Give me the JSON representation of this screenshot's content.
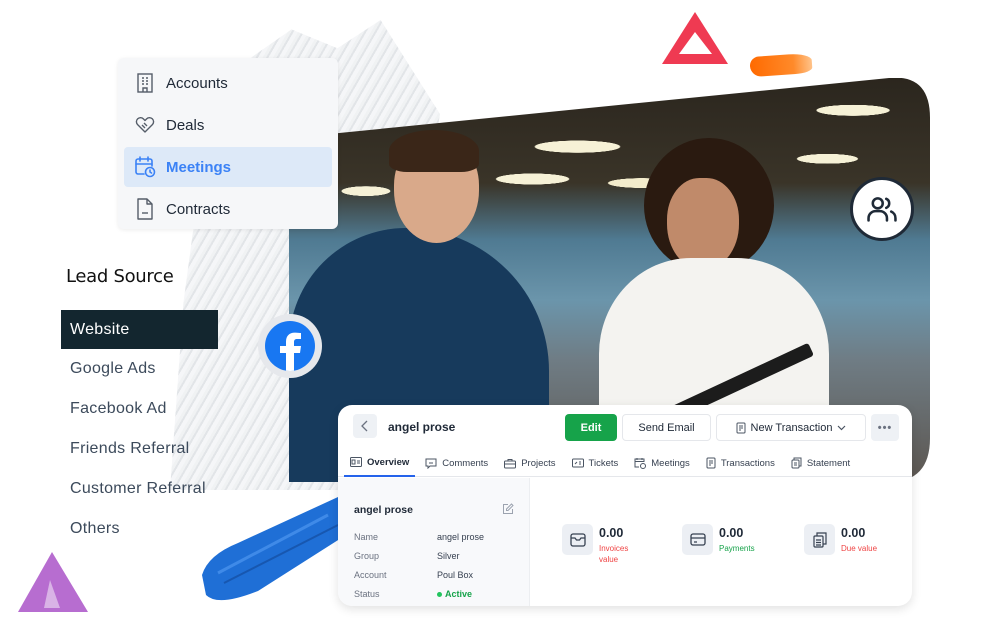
{
  "nav_menu": {
    "items": [
      {
        "label": "Accounts",
        "icon": "building-icon",
        "active": false
      },
      {
        "label": "Deals",
        "icon": "handshake-heart-icon",
        "active": false
      },
      {
        "label": "Meetings",
        "icon": "calendar-clock-icon",
        "active": true
      },
      {
        "label": "Contracts",
        "icon": "document-icon",
        "active": false
      }
    ]
  },
  "lead_source": {
    "title": "Lead Source",
    "items": [
      {
        "label": "Website",
        "active": true
      },
      {
        "label": "Google Ads",
        "active": false
      },
      {
        "label": "Facebook Ad",
        "active": false
      },
      {
        "label": "Friends Referral",
        "active": false
      },
      {
        "label": "Customer Referral",
        "active": false
      },
      {
        "label": "Others",
        "active": false
      }
    ]
  },
  "badges": {
    "people": "people-icon",
    "facebook": "facebook-icon"
  },
  "record": {
    "title": "angel prose",
    "buttons": {
      "edit": "Edit",
      "send_email": "Send Email",
      "new_transaction": "New Transaction",
      "more": "•••"
    },
    "tabs": [
      {
        "label": "Overview",
        "icon": "id-card-icon",
        "active": true
      },
      {
        "label": "Comments",
        "icon": "comment-icon",
        "active": false
      },
      {
        "label": "Projects",
        "icon": "briefcase-icon",
        "active": false
      },
      {
        "label": "Tickets",
        "icon": "ticket-icon",
        "active": false
      },
      {
        "label": "Meetings",
        "icon": "calendar-clock-icon",
        "active": false
      },
      {
        "label": "Transactions",
        "icon": "receipt-icon",
        "active": false
      },
      {
        "label": "Statement",
        "icon": "clipboard-icon",
        "active": false
      }
    ],
    "summary": {
      "title": "angel prose",
      "fields": [
        {
          "key": "Name",
          "value": "angel prose"
        },
        {
          "key": "Group",
          "value": "Silver"
        },
        {
          "key": "Account",
          "value": "Poul Box"
        },
        {
          "key": "Status",
          "value": "Active"
        }
      ]
    },
    "stats": [
      {
        "value": "0.00",
        "label": "Invoices value",
        "color": "#ef4444",
        "icon": "inbox-icon"
      },
      {
        "value": "0.00",
        "label": "Payments",
        "color": "#16a34a",
        "icon": "credit-card-icon"
      },
      {
        "value": "0.00",
        "label": "Due value",
        "color": "#ef4444",
        "icon": "clipboard-stack-icon"
      }
    ]
  },
  "colors": {
    "accent_blue": "#3b82f6",
    "active_nav_bg": "#dde9f8",
    "lead_active_bg": "#13262f",
    "edit_green": "#16a34a",
    "facebook_blue": "#1877f2"
  }
}
